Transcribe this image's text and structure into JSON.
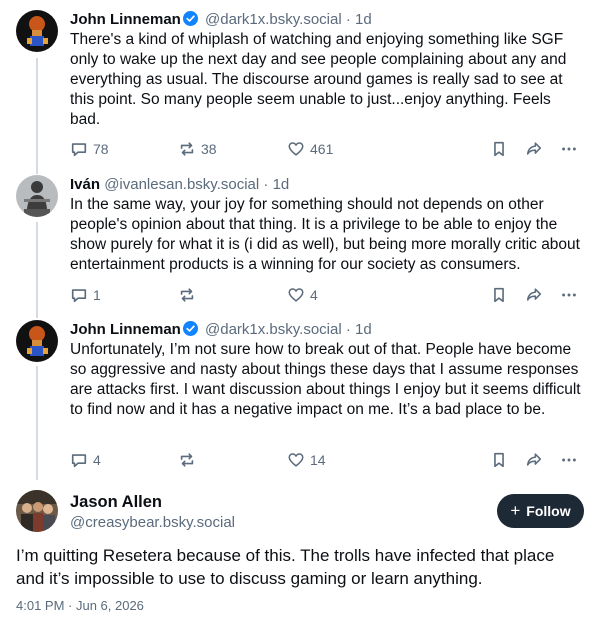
{
  "posts": [
    {
      "name": "John Linneman",
      "verified": true,
      "handle": "@dark1x.bsky.social",
      "separator": "·",
      "time": "1d",
      "text": "There's a kind of whiplash of watching and enjoying something like SGF only to wake up the next day and see people complaining about any and everything as usual. The discourse around games is really sad to see at this point. So many people seem unable to just...enjoy anything. Feels bad.",
      "replies": "78",
      "reposts": "38",
      "likes": "461"
    },
    {
      "name": "Iván",
      "verified": false,
      "handle": "@ivanlesan.bsky.social",
      "separator": "·",
      "time": "1d",
      "text": "In the same way, your joy for something should not depends on other people's opinion about that thing. It is a privilege to be able to enjoy the show purely for what it is (i did as well), but being more morally critic about entertainment products is a winning for our society as consumers.",
      "replies": "1",
      "reposts": "",
      "likes": "4"
    },
    {
      "name": "John Linneman",
      "verified": true,
      "handle": "@dark1x.bsky.social",
      "separator": "·",
      "time": "1d",
      "text": "Unfortunately, I’m not sure how to break out of that. People have become so aggressive and nasty about things these days that I assume responses are attacks first. I want discussion about things I enjoy but it seems difficult to find now and it has a negative impact on me. It’s a bad place to be.",
      "replies": "4",
      "reposts": "",
      "likes": "14"
    }
  ],
  "main_post": {
    "name": "Jason Allen",
    "handle": "@creasybear.bsky.social",
    "follow_label": "Follow",
    "follow_icon": "+",
    "text": "I’m quitting Resetera because of this. The trolls have infected that place and it’s impossible to use to discuss gaming or learn anything.",
    "date": "4:01 PM · Jun 6, 2026"
  },
  "colors": {
    "accent": "#1083fe",
    "muted": "#5b6b7c",
    "thread_line": "#d4dbe2",
    "follow_bg": "#1e2936"
  }
}
